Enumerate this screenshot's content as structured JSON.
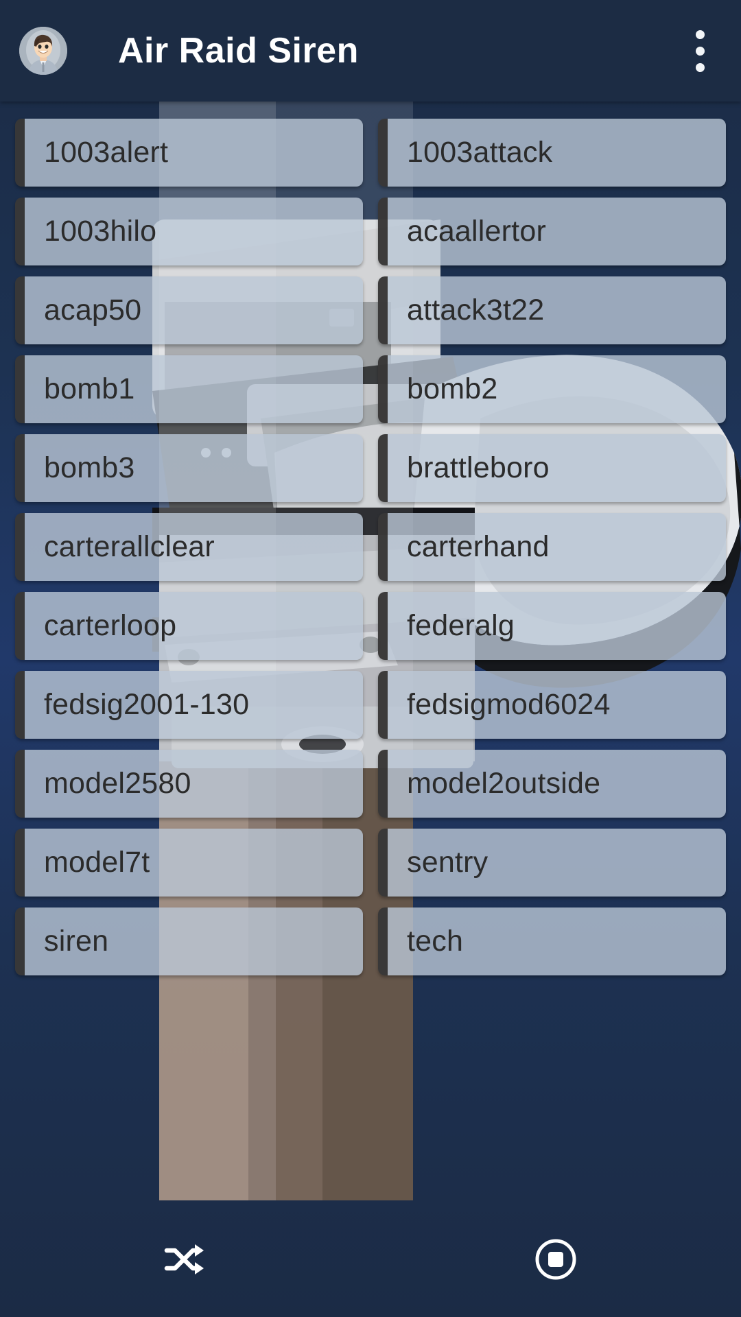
{
  "appbar": {
    "title": "Air Raid Siren",
    "avatar_icon": "user-avatar-icon",
    "overflow_icon": "overflow-menu-icon"
  },
  "colors": {
    "background_top": "#1b2b45",
    "background_mid": "#21396a",
    "appbar": "#1c2c44",
    "button_face": "#bac7d6",
    "button_accent": "#2a2826",
    "button_text": "#2b2b2b",
    "title_text": "#ffffff",
    "icon_white": "#ffffff"
  },
  "grid": {
    "columns": 2,
    "items": [
      {
        "label": "1003alert"
      },
      {
        "label": "1003attack"
      },
      {
        "label": "1003hilo"
      },
      {
        "label": "acaallertor"
      },
      {
        "label": "acap50"
      },
      {
        "label": "attack3t22"
      },
      {
        "label": "bomb1"
      },
      {
        "label": "bomb2"
      },
      {
        "label": "bomb3"
      },
      {
        "label": "brattleboro"
      },
      {
        "label": "carterallclear"
      },
      {
        "label": "carterhand"
      },
      {
        "label": "carterloop"
      },
      {
        "label": "federalg"
      },
      {
        "label": "fedsig2001-130"
      },
      {
        "label": "fedsigmod6024"
      },
      {
        "label": "model2580"
      },
      {
        "label": "model2outside"
      },
      {
        "label": "model7t"
      },
      {
        "label": "sentry"
      },
      {
        "label": "siren"
      },
      {
        "label": "tech"
      }
    ]
  },
  "bottombar": {
    "buttons": [
      {
        "icon": "shuffle-icon"
      },
      {
        "icon": "stop-icon"
      }
    ]
  },
  "background": {
    "artwork": "air-raid-siren-illustration"
  }
}
